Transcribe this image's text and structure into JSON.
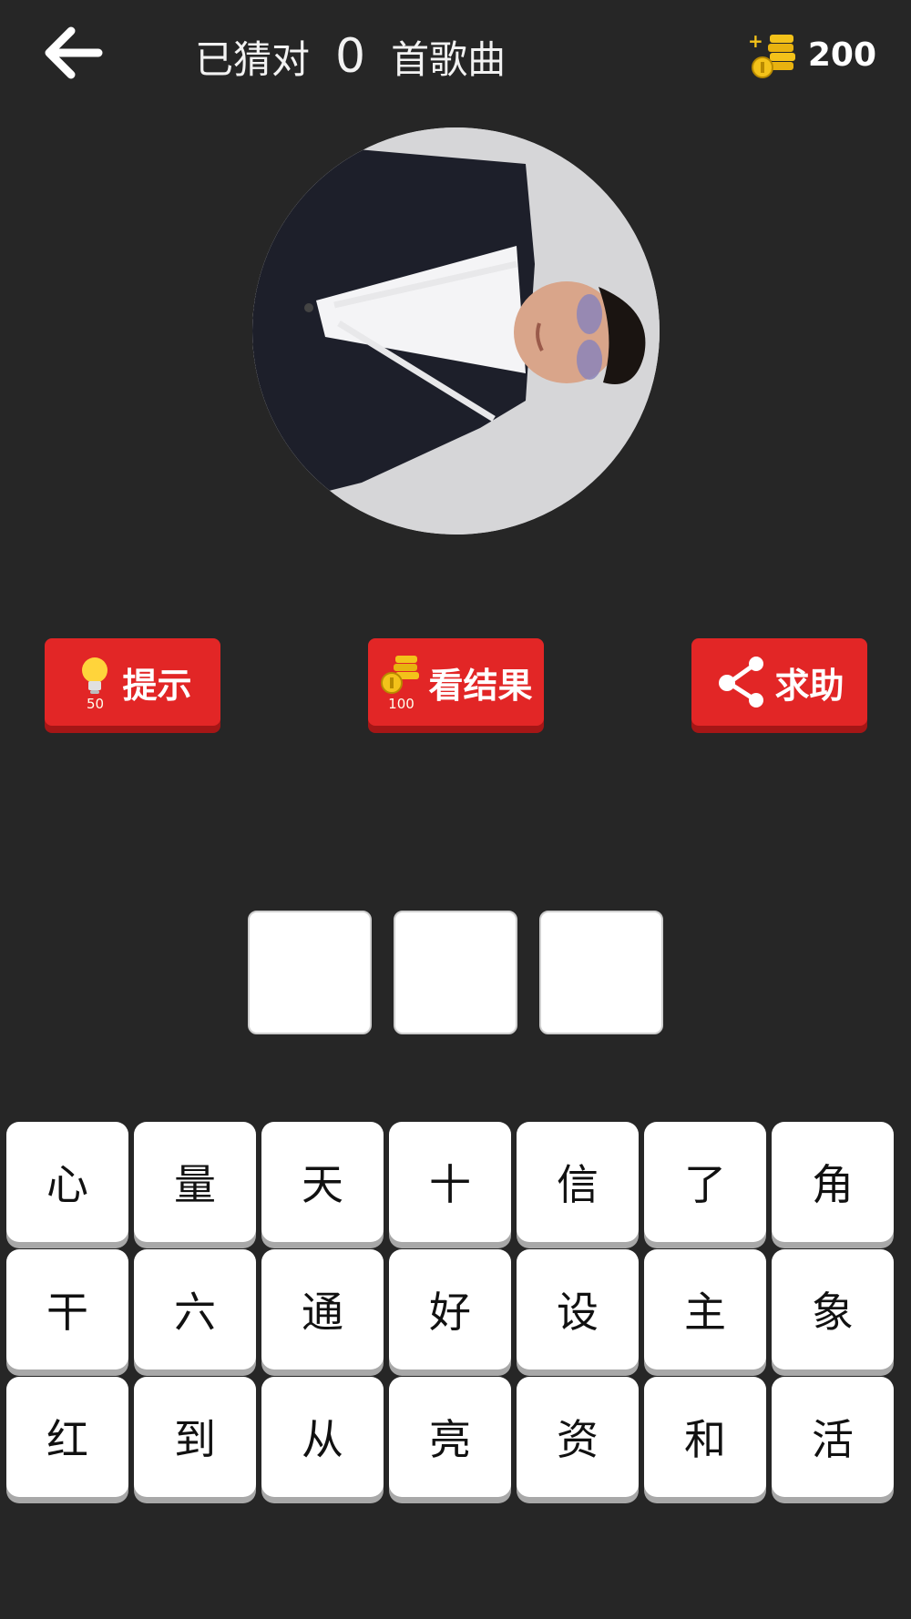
{
  "header": {
    "back_icon": "arrow-left-icon",
    "title_prefix": "已猜对",
    "guessed_count": "0",
    "title_suffix": "首歌曲",
    "coin_icon": "coins-add-icon",
    "coins": "200"
  },
  "photo": {
    "description_icon": "singer-photo"
  },
  "actions": [
    {
      "label": "提示",
      "cost": "50",
      "icon": "lightbulb-icon"
    },
    {
      "label": "看结果",
      "cost": "100",
      "icon": "coins-icon"
    },
    {
      "label": "求助",
      "icon": "share-icon"
    }
  ],
  "answer_slots": [
    "",
    "",
    ""
  ],
  "keys": [
    [
      "心",
      "量",
      "天",
      "十",
      "信",
      "了",
      "角"
    ],
    [
      "干",
      "六",
      "通",
      "好",
      "设",
      "主",
      "象"
    ],
    [
      "红",
      "到",
      "从",
      "亮",
      "资",
      "和",
      "活"
    ]
  ],
  "colors": {
    "background": "#262626",
    "button_red": "#e22626",
    "coin_gold": "#f3c21a"
  }
}
